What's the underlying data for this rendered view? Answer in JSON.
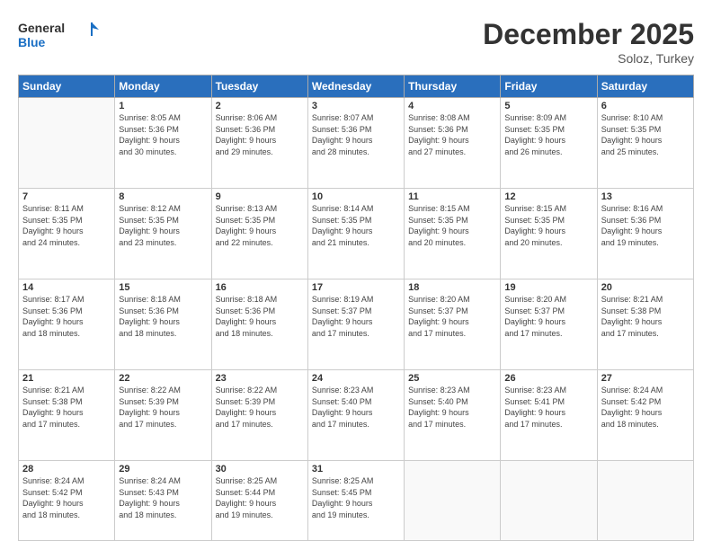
{
  "header": {
    "logo_line1": "General",
    "logo_line2": "Blue",
    "month": "December 2025",
    "location": "Soloz, Turkey"
  },
  "weekdays": [
    "Sunday",
    "Monday",
    "Tuesday",
    "Wednesday",
    "Thursday",
    "Friday",
    "Saturday"
  ],
  "weeks": [
    [
      {
        "day": "",
        "info": ""
      },
      {
        "day": "1",
        "info": "Sunrise: 8:05 AM\nSunset: 5:36 PM\nDaylight: 9 hours\nand 30 minutes."
      },
      {
        "day": "2",
        "info": "Sunrise: 8:06 AM\nSunset: 5:36 PM\nDaylight: 9 hours\nand 29 minutes."
      },
      {
        "day": "3",
        "info": "Sunrise: 8:07 AM\nSunset: 5:36 PM\nDaylight: 9 hours\nand 28 minutes."
      },
      {
        "day": "4",
        "info": "Sunrise: 8:08 AM\nSunset: 5:36 PM\nDaylight: 9 hours\nand 27 minutes."
      },
      {
        "day": "5",
        "info": "Sunrise: 8:09 AM\nSunset: 5:35 PM\nDaylight: 9 hours\nand 26 minutes."
      },
      {
        "day": "6",
        "info": "Sunrise: 8:10 AM\nSunset: 5:35 PM\nDaylight: 9 hours\nand 25 minutes."
      }
    ],
    [
      {
        "day": "7",
        "info": "Sunrise: 8:11 AM\nSunset: 5:35 PM\nDaylight: 9 hours\nand 24 minutes."
      },
      {
        "day": "8",
        "info": "Sunrise: 8:12 AM\nSunset: 5:35 PM\nDaylight: 9 hours\nand 23 minutes."
      },
      {
        "day": "9",
        "info": "Sunrise: 8:13 AM\nSunset: 5:35 PM\nDaylight: 9 hours\nand 22 minutes."
      },
      {
        "day": "10",
        "info": "Sunrise: 8:14 AM\nSunset: 5:35 PM\nDaylight: 9 hours\nand 21 minutes."
      },
      {
        "day": "11",
        "info": "Sunrise: 8:15 AM\nSunset: 5:35 PM\nDaylight: 9 hours\nand 20 minutes."
      },
      {
        "day": "12",
        "info": "Sunrise: 8:15 AM\nSunset: 5:35 PM\nDaylight: 9 hours\nand 20 minutes."
      },
      {
        "day": "13",
        "info": "Sunrise: 8:16 AM\nSunset: 5:36 PM\nDaylight: 9 hours\nand 19 minutes."
      }
    ],
    [
      {
        "day": "14",
        "info": "Sunrise: 8:17 AM\nSunset: 5:36 PM\nDaylight: 9 hours\nand 18 minutes."
      },
      {
        "day": "15",
        "info": "Sunrise: 8:18 AM\nSunset: 5:36 PM\nDaylight: 9 hours\nand 18 minutes."
      },
      {
        "day": "16",
        "info": "Sunrise: 8:18 AM\nSunset: 5:36 PM\nDaylight: 9 hours\nand 18 minutes."
      },
      {
        "day": "17",
        "info": "Sunrise: 8:19 AM\nSunset: 5:37 PM\nDaylight: 9 hours\nand 17 minutes."
      },
      {
        "day": "18",
        "info": "Sunrise: 8:20 AM\nSunset: 5:37 PM\nDaylight: 9 hours\nand 17 minutes."
      },
      {
        "day": "19",
        "info": "Sunrise: 8:20 AM\nSunset: 5:37 PM\nDaylight: 9 hours\nand 17 minutes."
      },
      {
        "day": "20",
        "info": "Sunrise: 8:21 AM\nSunset: 5:38 PM\nDaylight: 9 hours\nand 17 minutes."
      }
    ],
    [
      {
        "day": "21",
        "info": "Sunrise: 8:21 AM\nSunset: 5:38 PM\nDaylight: 9 hours\nand 17 minutes."
      },
      {
        "day": "22",
        "info": "Sunrise: 8:22 AM\nSunset: 5:39 PM\nDaylight: 9 hours\nand 17 minutes."
      },
      {
        "day": "23",
        "info": "Sunrise: 8:22 AM\nSunset: 5:39 PM\nDaylight: 9 hours\nand 17 minutes."
      },
      {
        "day": "24",
        "info": "Sunrise: 8:23 AM\nSunset: 5:40 PM\nDaylight: 9 hours\nand 17 minutes."
      },
      {
        "day": "25",
        "info": "Sunrise: 8:23 AM\nSunset: 5:40 PM\nDaylight: 9 hours\nand 17 minutes."
      },
      {
        "day": "26",
        "info": "Sunrise: 8:23 AM\nSunset: 5:41 PM\nDaylight: 9 hours\nand 17 minutes."
      },
      {
        "day": "27",
        "info": "Sunrise: 8:24 AM\nSunset: 5:42 PM\nDaylight: 9 hours\nand 18 minutes."
      }
    ],
    [
      {
        "day": "28",
        "info": "Sunrise: 8:24 AM\nSunset: 5:42 PM\nDaylight: 9 hours\nand 18 minutes."
      },
      {
        "day": "29",
        "info": "Sunrise: 8:24 AM\nSunset: 5:43 PM\nDaylight: 9 hours\nand 18 minutes."
      },
      {
        "day": "30",
        "info": "Sunrise: 8:25 AM\nSunset: 5:44 PM\nDaylight: 9 hours\nand 19 minutes."
      },
      {
        "day": "31",
        "info": "Sunrise: 8:25 AM\nSunset: 5:45 PM\nDaylight: 9 hours\nand 19 minutes."
      },
      {
        "day": "",
        "info": ""
      },
      {
        "day": "",
        "info": ""
      },
      {
        "day": "",
        "info": ""
      }
    ]
  ]
}
